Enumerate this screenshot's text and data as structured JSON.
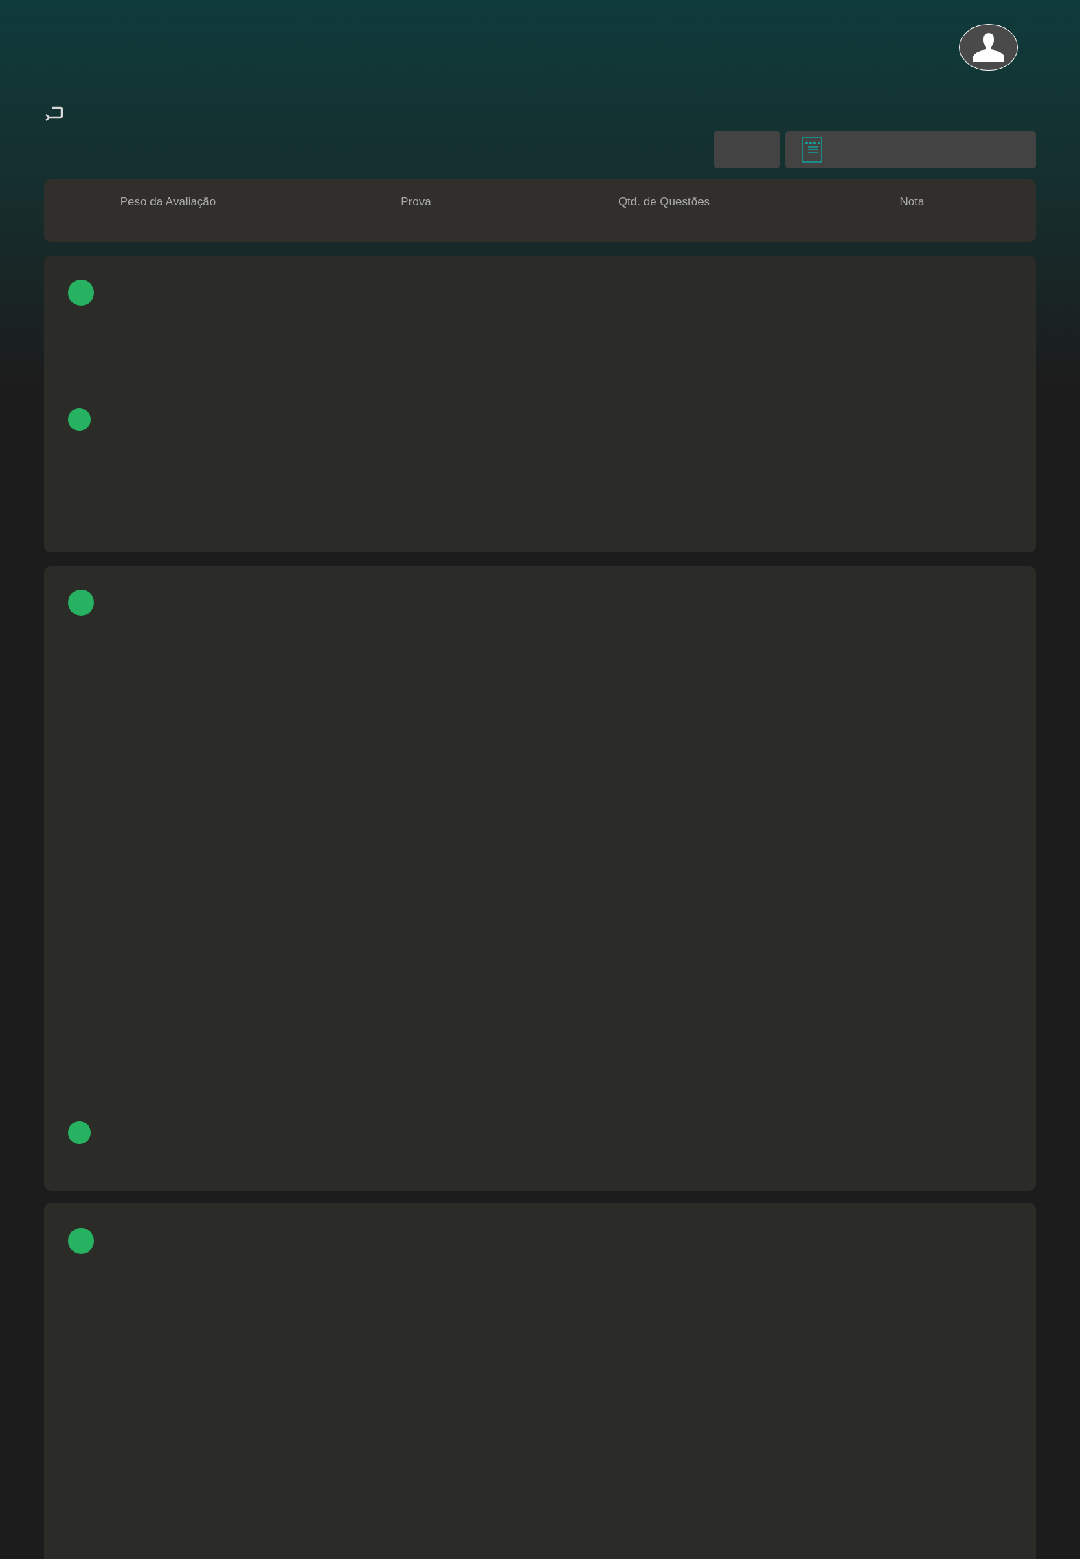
{
  "table": {
    "columns": [
      "Peso da Avaliação",
      "Prova",
      "Qtd. de Questões",
      "Nota"
    ]
  }
}
